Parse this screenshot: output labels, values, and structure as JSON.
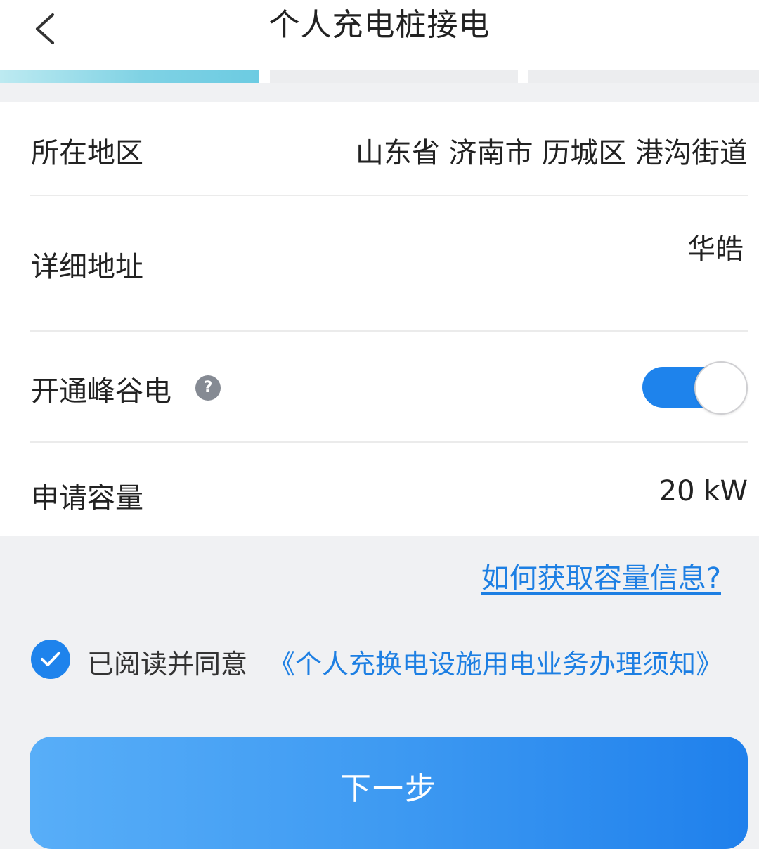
{
  "header": {
    "title": "个人充电桩接电",
    "back_icon": "chevron-left-icon"
  },
  "progress": {
    "total_steps": 3,
    "current_step": 1,
    "active_color": "#7FD2E4"
  },
  "form": {
    "region": {
      "label": "所在地区",
      "value": "山东省 济南市 历城区 港沟街道"
    },
    "address": {
      "label": "详细地址",
      "value": "华皓"
    },
    "peak_valley": {
      "label": "开通峰谷电",
      "help_icon": "question-mark-icon",
      "help_glyph": "?",
      "enabled": true,
      "toggle_color": "#1E83EC"
    },
    "capacity": {
      "label": "申请容量",
      "value": "20 kW"
    }
  },
  "capacity_link": "如何获取容量信息?",
  "agreement": {
    "checked": true,
    "check_icon": "checkmark-icon",
    "prefix": "已阅读并同意",
    "link": "《个人充换电设施用电业务办理须知》"
  },
  "next_button": {
    "label": "下一步"
  },
  "colors": {
    "accent": "#1E83EC",
    "link": "#1D7FE3",
    "background": "#F0F1F3"
  }
}
